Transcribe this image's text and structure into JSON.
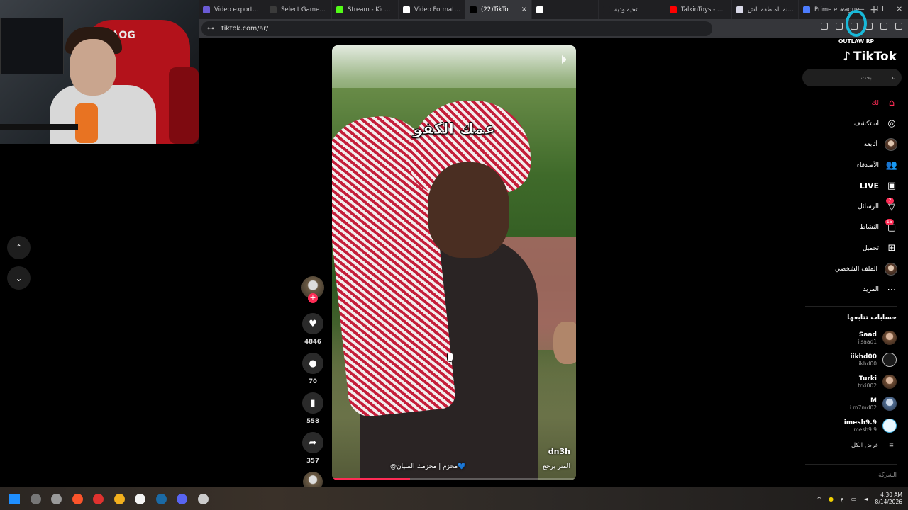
{
  "browser": {
    "tabs": [
      {
        "title": "Video exported |",
        "favicon_color": "#6b5bd6",
        "active": false
      },
      {
        "title": "Select Game - O",
        "favicon_color": "#3b3b3b",
        "active": false
      },
      {
        "title": "Stream - Kick Da",
        "favicon_color": "#53fc18",
        "active": false
      },
      {
        "title": "Video Format Sh",
        "favicon_color": "#ffffff",
        "active": false
      },
      {
        "title": "(22)TikTo",
        "favicon_color": "#000000",
        "active": true
      },
      {
        "title": "",
        "favicon_color": "#ffffff",
        "active": false
      },
      {
        "title": "تحية ودية",
        "favicon_color": "#1f1f22",
        "active": false
      },
      {
        "title": "TalkinToys - Befo",
        "favicon_color": "#ff0000",
        "active": false
      },
      {
        "title": "أمانة المنطقة الش",
        "favicon_color": "#d9d9e8",
        "active": false
      },
      {
        "title": "Prime eLeague",
        "favicon_color": "#4d7dff",
        "active": false
      }
    ],
    "close_glyph": "×",
    "new_tab_glyph": "+",
    "url": "tiktok.com/ar/",
    "window_controls": [
      "⌄",
      "—",
      "❐",
      "✕"
    ]
  },
  "watermark": {
    "text": "OUTLAW RP"
  },
  "cam": {
    "logo": "ᎪOG"
  },
  "nav": {
    "up_glyph": "⌃",
    "down_glyph": "⌄"
  },
  "video": {
    "caption": "عمك الكفو",
    "username": "dn3h",
    "description": "@محزم | محزمك المليان💙",
    "music": "المتر يرجع",
    "progress": 0.32
  },
  "actions": {
    "likes": "4846",
    "comments": "70",
    "saves": "558",
    "shares": "357"
  },
  "tiktok": {
    "logo": "TikTok",
    "search_placeholder": "بحث",
    "menu": [
      {
        "label": "لك",
        "icon": "home-icon",
        "glyph": "⌂"
      },
      {
        "label": "استكشف",
        "icon": "compass-icon",
        "glyph": "◎"
      },
      {
        "label": "أتابعه",
        "icon": "following-avatar-icon",
        "glyph": ""
      },
      {
        "label": "الأصدقاء",
        "icon": "friends-icon",
        "glyph": "👥"
      },
      {
        "label": "LIVE",
        "icon": "live-icon",
        "glyph": "▣"
      },
      {
        "label": "الرسائل",
        "icon": "messages-icon",
        "glyph": "▽",
        "badge": "7"
      },
      {
        "label": "النشاط",
        "icon": "activity-icon",
        "glyph": "▢",
        "badge": "15"
      },
      {
        "label": "تحميل",
        "icon": "upload-icon",
        "glyph": "⊞"
      },
      {
        "label": "الملف الشخصي",
        "icon": "profile-avatar-icon",
        "glyph": ""
      },
      {
        "label": "المزيد",
        "icon": "more-icon",
        "glyph": "⋯"
      }
    ],
    "following_heading": "حسابات تتابعها",
    "accounts": [
      {
        "name": "Saad",
        "handle": "iisaad1"
      },
      {
        "name": "iikhd00",
        "handle": "iikhd00"
      },
      {
        "name": "Turki",
        "handle": "trki002"
      },
      {
        "name": "M",
        "handle": "i.m7md02"
      },
      {
        "name": "imesh9.9",
        "handle": "imesh9.9"
      }
    ],
    "see_all": "عرض الكل",
    "company": "الشركة"
  },
  "taskbar": {
    "time": "4:30 AM",
    "date": "8/14/2026",
    "lang": "ع",
    "tray_glyph": "^",
    "apps": [
      {
        "name": "windows-start",
        "color": "#1f8fff"
      },
      {
        "name": "app-chrome-like",
        "color": "#777"
      },
      {
        "name": "app-speed",
        "color": "#9a9a9a"
      },
      {
        "name": "app-brave",
        "color": "#fb542b"
      },
      {
        "name": "app-adobe",
        "color": "#e0322f"
      },
      {
        "name": "app-feather",
        "color": "#f2b01e"
      },
      {
        "name": "app-steelseries",
        "color": "#f3f3f3"
      },
      {
        "name": "app-steam",
        "color": "#1b6aa5"
      },
      {
        "name": "app-discord",
        "color": "#5865f2"
      },
      {
        "name": "app-settings",
        "color": "#cccccc"
      }
    ]
  }
}
